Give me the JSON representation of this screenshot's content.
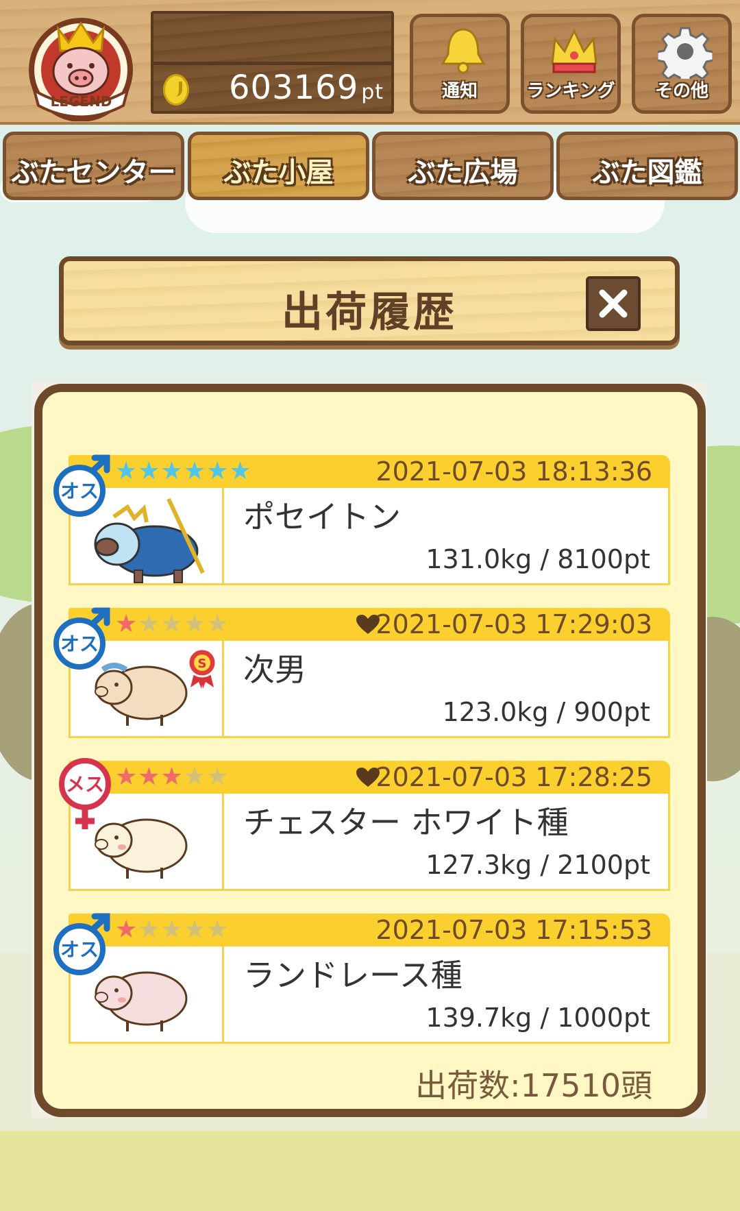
{
  "header": {
    "badge_text": "LEGEND",
    "points": "603169",
    "points_unit": "pt",
    "buttons": [
      {
        "label": "通知",
        "icon": "bell-icon"
      },
      {
        "label": "ランキング",
        "icon": "crown-icon"
      },
      {
        "label": "その他",
        "icon": "gear-icon"
      }
    ]
  },
  "tabs": [
    {
      "label": "ぶたセンター",
      "active": false
    },
    {
      "label": "ぶた小屋",
      "active": true
    },
    {
      "label": "ぶた広場",
      "active": false
    },
    {
      "label": "ぶた図鑑",
      "active": false
    }
  ],
  "dialog": {
    "title": "出荷履歴",
    "close_icon": "close-icon"
  },
  "entries": [
    {
      "gender": "オス",
      "stars_filled": 6,
      "stars_total": 6,
      "favorite": false,
      "ribbon": false,
      "timestamp": "2021-07-03 18:13:36",
      "name": "ポセイトン",
      "stats": "131.0kg / 8100pt"
    },
    {
      "gender": "オス",
      "stars_filled": 1,
      "stars_total": 5,
      "favorite": true,
      "ribbon": true,
      "ribbon_text": "S",
      "timestamp": "2021-07-03 17:29:03",
      "name": "次男",
      "stats": "123.0kg / 900pt"
    },
    {
      "gender": "メス",
      "stars_filled": 3,
      "stars_total": 5,
      "favorite": true,
      "ribbon": false,
      "timestamp": "2021-07-03 17:28:25",
      "name": "チェスター ホワイト種",
      "stats": "127.3kg / 2100pt"
    },
    {
      "gender": "オス",
      "stars_filled": 1,
      "stars_total": 5,
      "favorite": false,
      "ribbon": false,
      "timestamp": "2021-07-03 17:15:53",
      "name": "ランドレース種",
      "stats": "139.7kg / 1000pt"
    }
  ],
  "footer": {
    "shipment_count": "出荷数:17510頭"
  },
  "colors": {
    "wood_dark": "#6e4a2a",
    "panel_bg": "#fff7c4",
    "entry_header": "#fbcf2e",
    "male_blue": "#1f6fc0",
    "female_red": "#d6334d",
    "star_on": "#f06a6a",
    "star_rare": "#4fc6e8"
  }
}
